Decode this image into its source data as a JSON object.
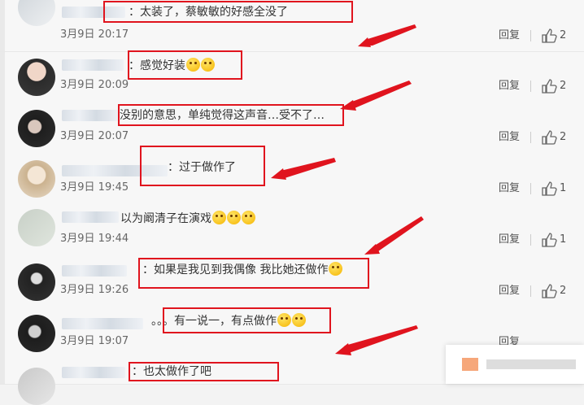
{
  "reply_label": "回复",
  "comments": [
    {
      "text": "：太装了，蔡敏敏的好感全没了",
      "time": "3月9日 20:17",
      "likes": "2",
      "emoji_count": 0
    },
    {
      "text": "：感觉好装",
      "time": "3月9日 20:09",
      "likes": "2",
      "emoji_count": 2
    },
    {
      "text": "没别的意思，单纯觉得这声音…受不了…",
      "time": "3月9日 20:07",
      "likes": "2",
      "emoji_count": 0
    },
    {
      "text": "：过于做作了",
      "time": "3月9日 19:45",
      "likes": "1",
      "emoji_count": 0
    },
    {
      "text": "以为阚清子在演戏",
      "time": "3月9日 19:44",
      "likes": "1",
      "emoji_count": 3
    },
    {
      "text": "：如果是我见到我偶像 我比她还做作",
      "time": "3月9日 19:26",
      "likes": "2",
      "emoji_count": 1
    },
    {
      "text": "。。。有一说一，有点做作",
      "time": "3月9日 19:07",
      "likes": "",
      "emoji_count": 2
    },
    {
      "text": "：也太做作了吧",
      "time": "",
      "likes": "",
      "emoji_count": 0
    }
  ],
  "colors": {
    "highlight": "#e0141e",
    "background": "#f7f7f7"
  }
}
